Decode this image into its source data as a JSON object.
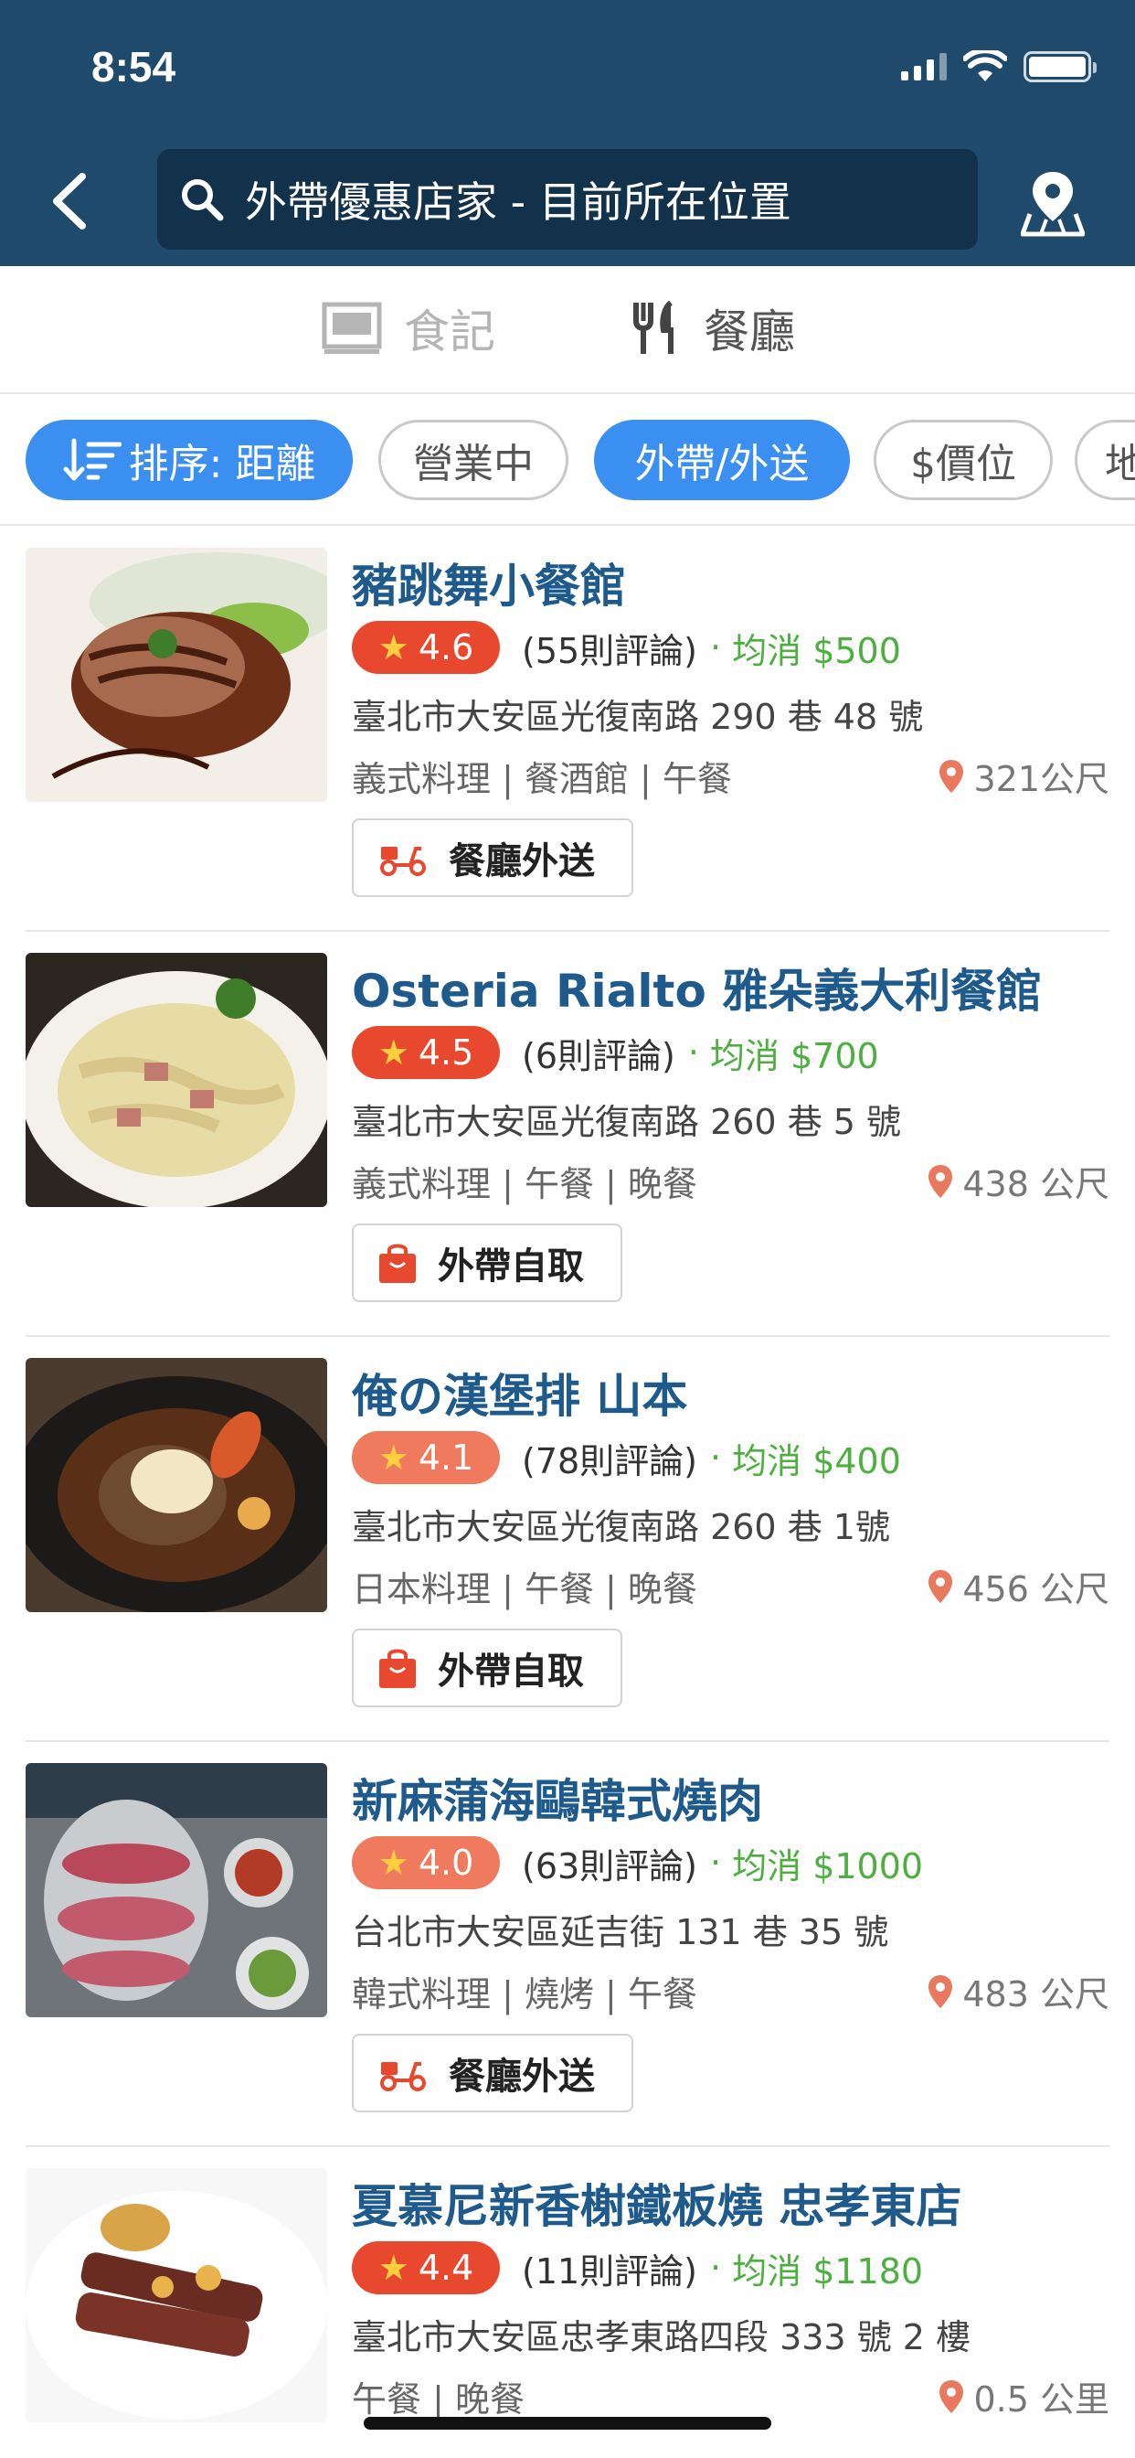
{
  "status_bar": {
    "time": "8:54"
  },
  "header": {
    "search_text": "外帶優惠店家 - 目前所在位置",
    "colors": {
      "background": "#1f4a6b",
      "search_bg": "#12314a"
    }
  },
  "tabs": [
    {
      "label": "食記",
      "active": false,
      "icon": "notebook-icon"
    },
    {
      "label": "餐廳",
      "active": true,
      "icon": "fork-knife-icon"
    }
  ],
  "filters": [
    {
      "label": "排序: 距離",
      "active": true,
      "icon": "sort-icon"
    },
    {
      "label": "營業中",
      "active": false
    },
    {
      "label": "外帶/外送",
      "active": true
    },
    {
      "label": "$價位",
      "active": false
    },
    {
      "label": "地",
      "active": false
    }
  ],
  "restaurants": [
    {
      "name": "豬跳舞小餐館",
      "rating": "4.6",
      "rating_color": "#e8492e",
      "reviews": "(55則評論)",
      "avg_price": "均消 $500",
      "address": "臺北市大安區光復南路 290 巷 48 號",
      "categories": "義式料理 | 餐酒館 | 午餐",
      "distance": "321公尺",
      "service": "餐廳外送",
      "service_icon": "scooter-icon"
    },
    {
      "name": "Osteria Rialto 雅朵義大利餐館",
      "rating": "4.5",
      "rating_color": "#e8492e",
      "reviews": "(6則評論)",
      "avg_price": "均消 $700",
      "address": "臺北市大安區光復南路 260 巷 5 號",
      "categories": "義式料理 | 午餐 | 晚餐",
      "distance": "438 公尺",
      "service": "外帶自取",
      "service_icon": "shopping-bag-icon"
    },
    {
      "name": "俺の漢堡排 山本",
      "rating": "4.1",
      "rating_color": "#ef7a5e",
      "reviews": "(78則評論)",
      "avg_price": "均消 $400",
      "address": "臺北市大安區光復南路 260 巷 1號",
      "categories": "日本料理 | 午餐 | 晚餐",
      "distance": "456 公尺",
      "service": "外帶自取",
      "service_icon": "shopping-bag-icon"
    },
    {
      "name": "新麻蒲海鷗韓式燒肉",
      "rating": "4.0",
      "rating_color": "#ef7a5e",
      "reviews": "(63則評論)",
      "avg_price": "均消 $1000",
      "address": "台北市大安區延吉街 131 巷 35 號",
      "categories": "韓式料理 | 燒烤 | 午餐",
      "distance": "483 公尺",
      "service": "餐廳外送",
      "service_icon": "scooter-icon"
    },
    {
      "name": "夏慕尼新香榭鐵板燒 忠孝東店",
      "rating": "4.4",
      "rating_color": "#e8492e",
      "reviews": "(11則評論)",
      "avg_price": "均消 $1180",
      "address": "臺北市大安區忠孝東路四段 333 號 2 樓",
      "categories": "午餐 | 晚餐",
      "distance": "0.5 公里",
      "service": "",
      "service_icon": ""
    }
  ],
  "colors": {
    "accent": "#3b8ff0",
    "name": "#1e5a8c",
    "price": "#4caf3f",
    "pin": "#e8795f"
  }
}
